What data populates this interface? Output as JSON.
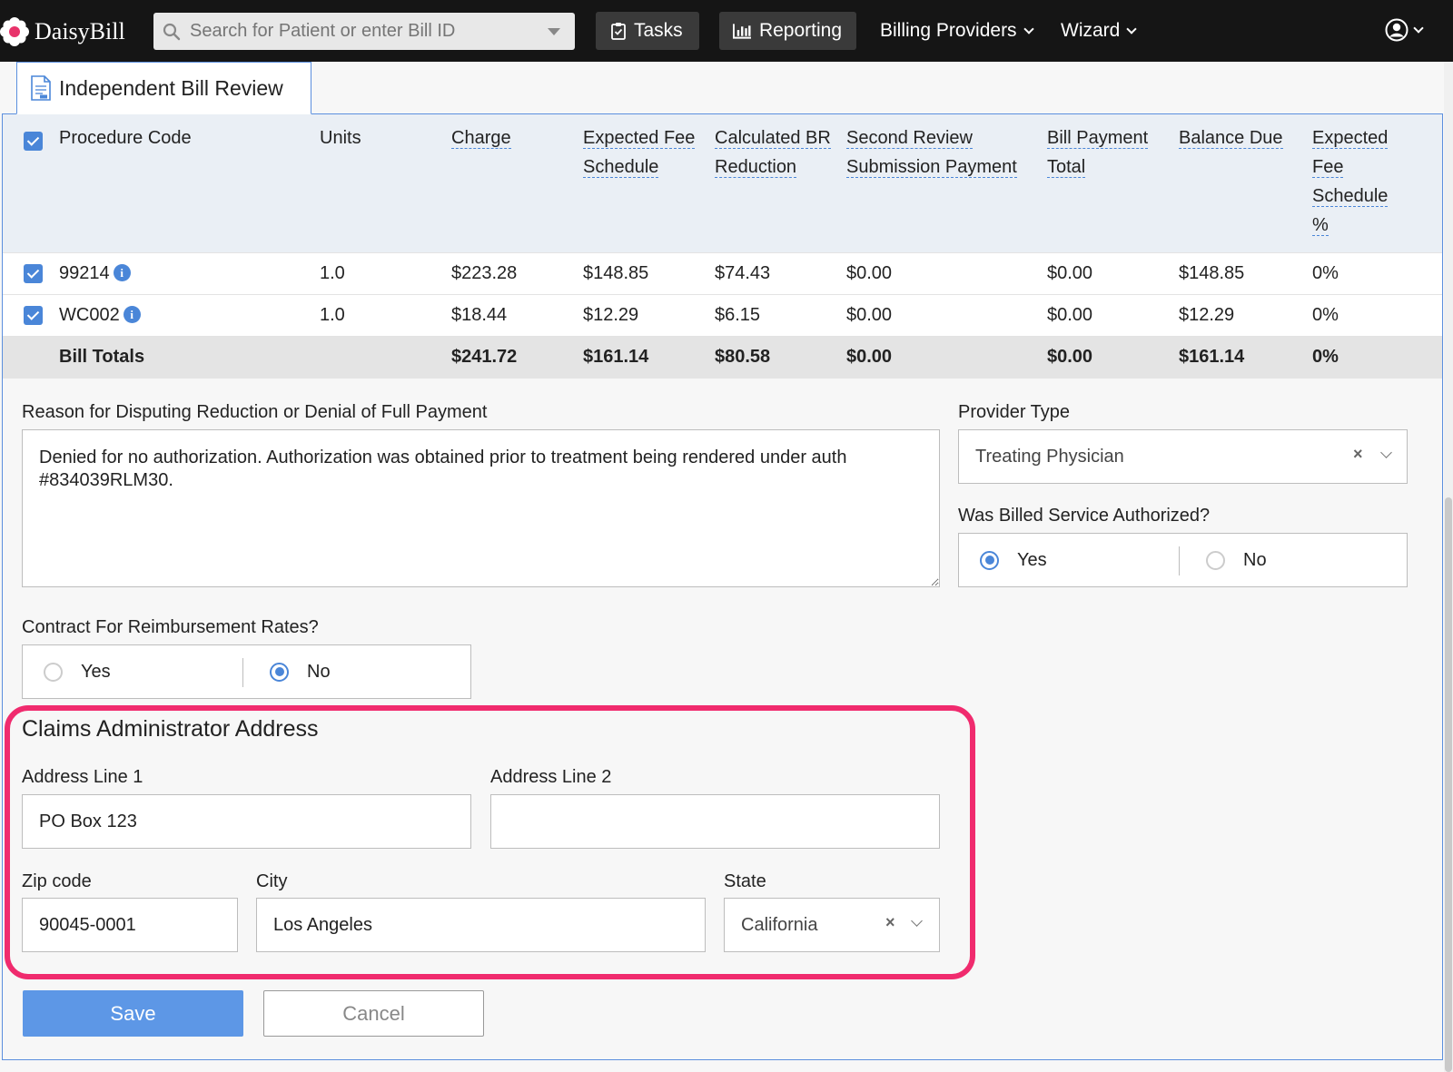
{
  "app": {
    "name": "DaisyBill"
  },
  "search": {
    "placeholder": "Search for Patient or enter Bill ID"
  },
  "nav": {
    "tasks": "Tasks",
    "reporting": "Reporting",
    "billing_providers": "Billing Providers",
    "wizard": "Wizard"
  },
  "tab": {
    "label": "Independent Bill Review"
  },
  "table": {
    "headers": {
      "procedure_code": "Procedure Code",
      "units": "Units",
      "charge": "Charge",
      "expected_fee_1": "Expected Fee",
      "expected_fee_2": "Schedule",
      "calc_br_1": "Calculated BR",
      "calc_br_2": "Reduction",
      "second_review_1": "Second Review",
      "second_review_2": "Submission Payment",
      "bill_payment_1": "Bill Payment",
      "bill_payment_2": "Total",
      "balance_due": "Balance Due",
      "efs_pct_1": "Expected",
      "efs_pct_2": "Fee",
      "efs_pct_3": "Schedule",
      "efs_pct_4": "%"
    },
    "rows": [
      {
        "code": "99214",
        "units": "1.0",
        "charge": "$223.28",
        "expected_fee": "$148.85",
        "calc_br": "$74.43",
        "second_review": "$0.00",
        "bill_payment": "$0.00",
        "balance_due": "$148.85",
        "efs_pct": "0%"
      },
      {
        "code": "WC002",
        "units": "1.0",
        "charge": "$18.44",
        "expected_fee": "$12.29",
        "calc_br": "$6.15",
        "second_review": "$0.00",
        "bill_payment": "$0.00",
        "balance_due": "$12.29",
        "efs_pct": "0%"
      }
    ],
    "totals": {
      "label": "Bill Totals",
      "charge": "$241.72",
      "expected_fee": "$161.14",
      "calc_br": "$80.58",
      "second_review": "$0.00",
      "bill_payment": "$0.00",
      "balance_due": "$161.14",
      "efs_pct": "0%"
    }
  },
  "dispute": {
    "label": "Reason for Disputing Reduction or Denial of Full Payment",
    "value": "Denied for no authorization. Authorization was obtained prior to treatment being rendered under auth #834039RLM30."
  },
  "provider_type": {
    "label": "Provider Type",
    "value": "Treating Physician"
  },
  "authorized": {
    "label": "Was Billed Service Authorized?",
    "yes": "Yes",
    "no": "No",
    "selected": "Yes"
  },
  "contract": {
    "label": "Contract For Reimbursement Rates?",
    "yes": "Yes",
    "no": "No",
    "selected": "No"
  },
  "claims_admin": {
    "title": "Claims Administrator Address",
    "address1_label": "Address Line 1",
    "address1_value": "PO Box 123",
    "address2_label": "Address Line 2",
    "address2_value": "",
    "zip_label": "Zip code",
    "zip_value": "90045-0001",
    "city_label": "City",
    "city_value": "Los Angeles",
    "state_label": "State",
    "state_value": "California"
  },
  "actions": {
    "save": "Save",
    "cancel": "Cancel"
  },
  "colors": {
    "accent": "#4a86d8",
    "highlight": "#f02b6e",
    "nav_bg": "#151515",
    "save_bg": "#5d97e6"
  },
  "icons": [
    "daisy-logo-icon",
    "search-icon",
    "clipboard-check-icon",
    "bar-chart-icon",
    "chevron-down-icon",
    "user-circle-icon",
    "document-icon",
    "info-icon",
    "clear-x-icon"
  ]
}
